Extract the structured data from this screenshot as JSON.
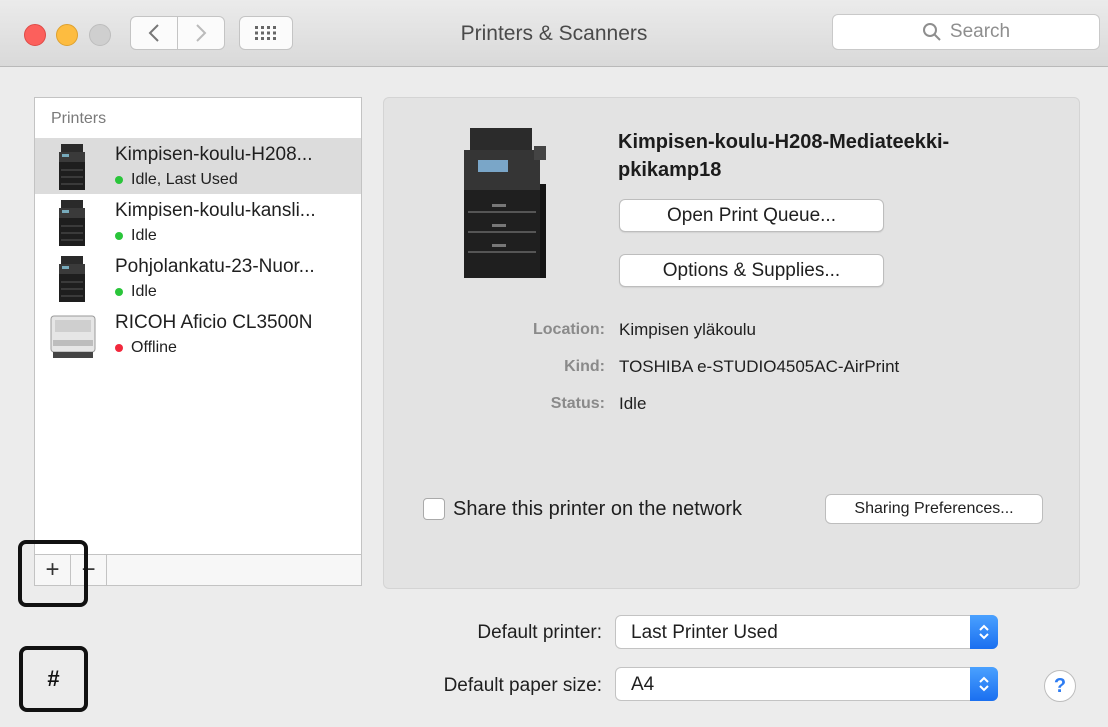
{
  "window": {
    "title": "Printers & Scanners",
    "search_placeholder": "Search"
  },
  "printer_list": {
    "header": "Printers",
    "items": [
      {
        "name": "Kimpisen-koulu-H208...",
        "status": "Idle, Last Used",
        "status_color": "#2ac53a",
        "selected": true
      },
      {
        "name": "Kimpisen-koulu-kansli...",
        "status": "Idle",
        "status_color": "#2ac53a",
        "selected": false
      },
      {
        "name": "Pohjolankatu-23-Nuor...",
        "status": "Idle",
        "status_color": "#2ac53a",
        "selected": false
      },
      {
        "name": "RICOH Aficio CL3500N",
        "status": "Offline",
        "status_color": "#f2283c",
        "selected": false
      }
    ],
    "add_label": "+",
    "remove_label": "−"
  },
  "annotations": {
    "hash_label": "#"
  },
  "detail": {
    "printer_name": "Kimpisen-koulu-H208-Mediateekki-pkikamp18",
    "open_queue_label": "Open Print Queue...",
    "options_label": "Options & Supplies...",
    "location_label": "Location:",
    "location_value": "Kimpisen yläkoulu",
    "kind_label": "Kind:",
    "kind_value": "TOSHIBA e-STUDIO4505AC-AirPrint",
    "status_label": "Status:",
    "status_value": "Idle",
    "share_label": "Share this printer on the network",
    "sharing_prefs_label": "Sharing Preferences..."
  },
  "defaults": {
    "printer_label": "Default printer:",
    "printer_value": "Last Printer Used",
    "paper_label": "Default paper size:",
    "paper_value": "A4",
    "help_label": "?"
  },
  "colors": {
    "accent": "#1a6ff0",
    "idle": "#2ac53a",
    "offline": "#f2283c"
  }
}
